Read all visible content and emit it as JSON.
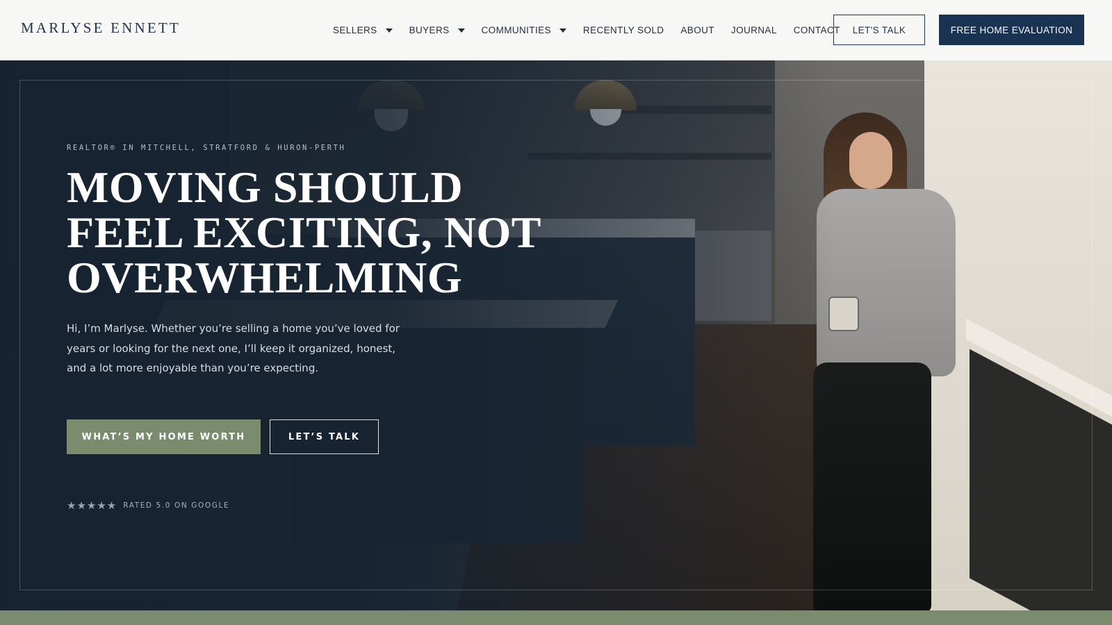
{
  "brand": {
    "logo": "MARLYSE ENNETT"
  },
  "nav": {
    "items": [
      {
        "label": "SELLERS",
        "dropdown": true
      },
      {
        "label": "BUYERS",
        "dropdown": true
      },
      {
        "label": "COMMUNITIES",
        "dropdown": true
      },
      {
        "label": "RECENTLY SOLD",
        "dropdown": false
      },
      {
        "label": "ABOUT",
        "dropdown": false
      },
      {
        "label": "JOURNAL",
        "dropdown": false
      },
      {
        "label": "CONTACT",
        "dropdown": false
      }
    ],
    "talk_button": "LET'S TALK",
    "evaluation_button": "FREE HOME EVALUATION"
  },
  "hero": {
    "eyebrow": "REALTOR® IN MITCHELL, STRATFORD & HURON-PERTH",
    "headline_lines": [
      "MOVING SHOULD",
      "FEEL EXCITING, NOT",
      "OVERWHELMING"
    ],
    "intro": "Hi, I’m Marlyse. Whether you’re selling a home you’ve loved for years or looking for the next one, I’ll keep it organized, honest, and a lot more enjoyable than you’re expecting.",
    "primary_button": "WHAT’S MY HOME WORTH",
    "secondary_button": "LET’S TALK",
    "rating": {
      "stars": "★★★★★",
      "text": "RATED 5.0 ON GOOGLE"
    }
  },
  "colors": {
    "navy": "#1a3352",
    "sage": "#7a8b6e",
    "header_bg": "#f7f7f5"
  }
}
